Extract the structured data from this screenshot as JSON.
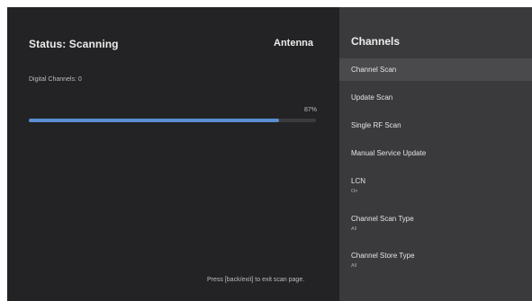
{
  "scan": {
    "status": "Status: Scanning",
    "source": "Antenna",
    "digital_channels": "Digital Channels: 0",
    "progress_text": "87%",
    "progress_fraction": 0.87,
    "hint": "Press [back/exit] to exit scan page."
  },
  "panel": {
    "title": "Channels",
    "items": [
      {
        "label": "Channel Scan",
        "sub": ""
      },
      {
        "label": "Update Scan",
        "sub": ""
      },
      {
        "label": "Single RF Scan",
        "sub": ""
      },
      {
        "label": "Manual Service Update",
        "sub": ""
      },
      {
        "label": "LCN",
        "sub": "On"
      },
      {
        "label": "Channel Scan Type",
        "sub": "All"
      },
      {
        "label": "Channel Store Type",
        "sub": "All"
      }
    ]
  },
  "colors": {
    "progress_fill": "#5b8ed3",
    "panel_background": "#3a3a3c",
    "screen_background": "#232325"
  }
}
